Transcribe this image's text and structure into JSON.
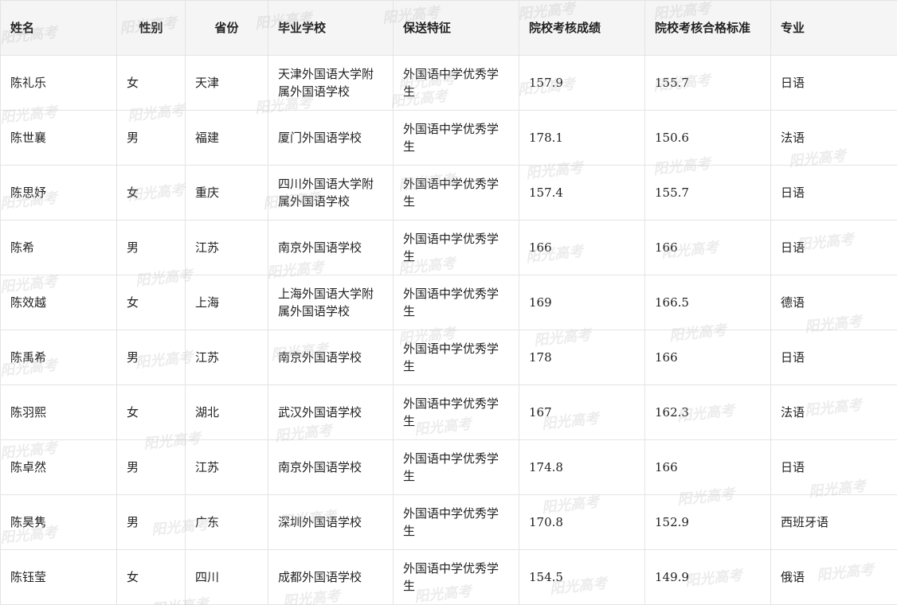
{
  "table": {
    "headers": [
      "姓名",
      "性别",
      "省份",
      "毕业学校",
      "保送特征",
      "院校考核成绩",
      "院校考核合格标准",
      "专业"
    ],
    "rows": [
      {
        "name": "陈礼乐",
        "gender": "女",
        "province": "天津",
        "school": "天津外国语大学附属外国语学校",
        "feature": "外国语中学优秀学生",
        "score": "157.9",
        "standard": "155.7",
        "major": "日语"
      },
      {
        "name": "陈世襄",
        "gender": "男",
        "province": "福建",
        "school": "厦门外国语学校",
        "feature": "外国语中学优秀学生",
        "score": "178.1",
        "standard": "150.6",
        "major": "法语"
      },
      {
        "name": "陈思妤",
        "gender": "女",
        "province": "重庆",
        "school": "四川外国语大学附属外国语学校",
        "feature": "外国语中学优秀学生",
        "score": "157.4",
        "standard": "155.7",
        "major": "日语"
      },
      {
        "name": "陈希",
        "gender": "男",
        "province": "江苏",
        "school": "南京外国语学校",
        "feature": "外国语中学优秀学生",
        "score": "166",
        "standard": "166",
        "major": "日语"
      },
      {
        "name": "陈效越",
        "gender": "女",
        "province": "上海",
        "school": "上海外国语大学附属外国语学校",
        "feature": "外国语中学优秀学生",
        "score": "169",
        "standard": "166.5",
        "major": "德语"
      },
      {
        "name": "陈禹希",
        "gender": "男",
        "province": "江苏",
        "school": "南京外国语学校",
        "feature": "外国语中学优秀学生",
        "score": "178",
        "standard": "166",
        "major": "日语"
      },
      {
        "name": "陈羽熙",
        "gender": "女",
        "province": "湖北",
        "school": "武汉外国语学校",
        "feature": "外国语中学优秀学生",
        "score": "167",
        "standard": "162.3",
        "major": "法语"
      },
      {
        "name": "陈卓然",
        "gender": "男",
        "province": "江苏",
        "school": "南京外国语学校",
        "feature": "外国语中学优秀学生",
        "score": "174.8",
        "standard": "166",
        "major": "日语"
      },
      {
        "name": "陈昊隽",
        "gender": "男",
        "province": "广东",
        "school": "深圳外国语学校",
        "feature": "外国语中学优秀学生",
        "score": "170.8",
        "standard": "152.9",
        "major": "西班牙语"
      },
      {
        "name": "陈钰莹",
        "gender": "女",
        "province": "四川",
        "school": "成都外国语学校",
        "feature": "外国语中学优秀学生",
        "score": "154.5",
        "standard": "149.9",
        "major": "俄语"
      }
    ]
  },
  "watermark": {
    "text": "阳光高考"
  }
}
